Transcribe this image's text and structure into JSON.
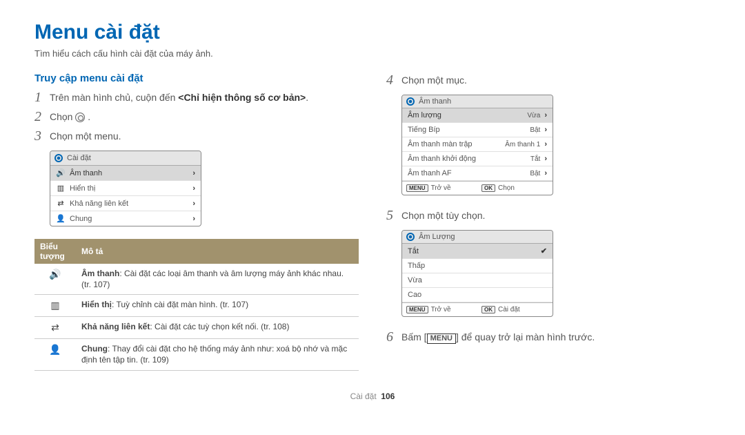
{
  "page": {
    "title": "Menu cài đặt",
    "subtitle": "Tìm hiểu cách cấu hình cài đặt của máy ảnh."
  },
  "left": {
    "section_title": "Truy cập menu cài đặt",
    "steps": {
      "s1": {
        "num": "1",
        "pre": "Trên màn hình chủ, cuộn đến ",
        "bold": "<Chỉ hiện thông số cơ bản>",
        "post": "."
      },
      "s2": {
        "num": "2",
        "pre": "Chọn ",
        "post": "."
      },
      "s3": {
        "num": "3",
        "text": "Chọn một menu."
      }
    },
    "menu1": {
      "header": "Cài đặt",
      "rows": [
        {
          "icon": "🔊",
          "label": "Âm thanh",
          "selected": true
        },
        {
          "icon": "▥",
          "label": "Hiển thị"
        },
        {
          "icon": "⇄",
          "label": "Khả năng liên kết"
        },
        {
          "icon": "👤",
          "label": "Chung"
        }
      ]
    },
    "table": {
      "col1": "Biểu tượng",
      "col2": "Mô tả",
      "rows": [
        {
          "icon": "🔊",
          "bold": "Âm thanh",
          "text": ": Cài đặt các loại âm thanh và âm lượng máy ảnh khác nhau. (tr. 107)"
        },
        {
          "icon": "▥",
          "bold": "Hiển thị",
          "text": ": Tuỳ chỉnh cài đặt màn hình. (tr. 107)"
        },
        {
          "icon": "⇄",
          "bold": "Khả năng liên kết",
          "text": ": Cài đặt các tuỳ chọn kết nối. (tr. 108)"
        },
        {
          "icon": "👤",
          "bold": "Chung",
          "text": ": Thay đổi cài đặt cho hệ thống máy ảnh như: xoá bộ nhớ và mặc định tên tập tin. (tr. 109)"
        }
      ]
    }
  },
  "right": {
    "steps": {
      "s4": {
        "num": "4",
        "text": "Chọn một mục."
      },
      "s5": {
        "num": "5",
        "text": "Chọn một tùy chọn."
      },
      "s6": {
        "num": "6",
        "pre": "Bấm [",
        "key": "MENU",
        "post": "] để quay trở lại màn hình trước."
      }
    },
    "menu2": {
      "header": "Âm thanh",
      "rows": [
        {
          "label": "Âm lượng",
          "value": "Vừa",
          "chevron": true,
          "selected": true
        },
        {
          "label": "Tiếng Bíp",
          "value": "Bật",
          "chevron": true
        },
        {
          "label": "Âm thanh màn trập",
          "value": "Âm thanh 1",
          "chevron": true
        },
        {
          "label": "Âm thanh khởi động",
          "value": "Tắt",
          "chevron": true
        },
        {
          "label": "Âm thanh AF",
          "value": "Bật",
          "chevron": true
        }
      ],
      "footer": {
        "left_key": "MENU",
        "left_label": "Trở về",
        "right_key": "OK",
        "right_label": "Chọn"
      }
    },
    "menu3": {
      "header": "Âm Lượng",
      "rows": [
        {
          "label": "Tắt",
          "check": true,
          "selected": true
        },
        {
          "label": "Thấp"
        },
        {
          "label": "Vừa"
        },
        {
          "label": "Cao"
        }
      ],
      "footer": {
        "left_key": "MENU",
        "left_label": "Trở về",
        "right_key": "OK",
        "right_label": "Cài đặt"
      }
    }
  },
  "footer": {
    "label": "Cài đặt",
    "page_number": "106"
  }
}
